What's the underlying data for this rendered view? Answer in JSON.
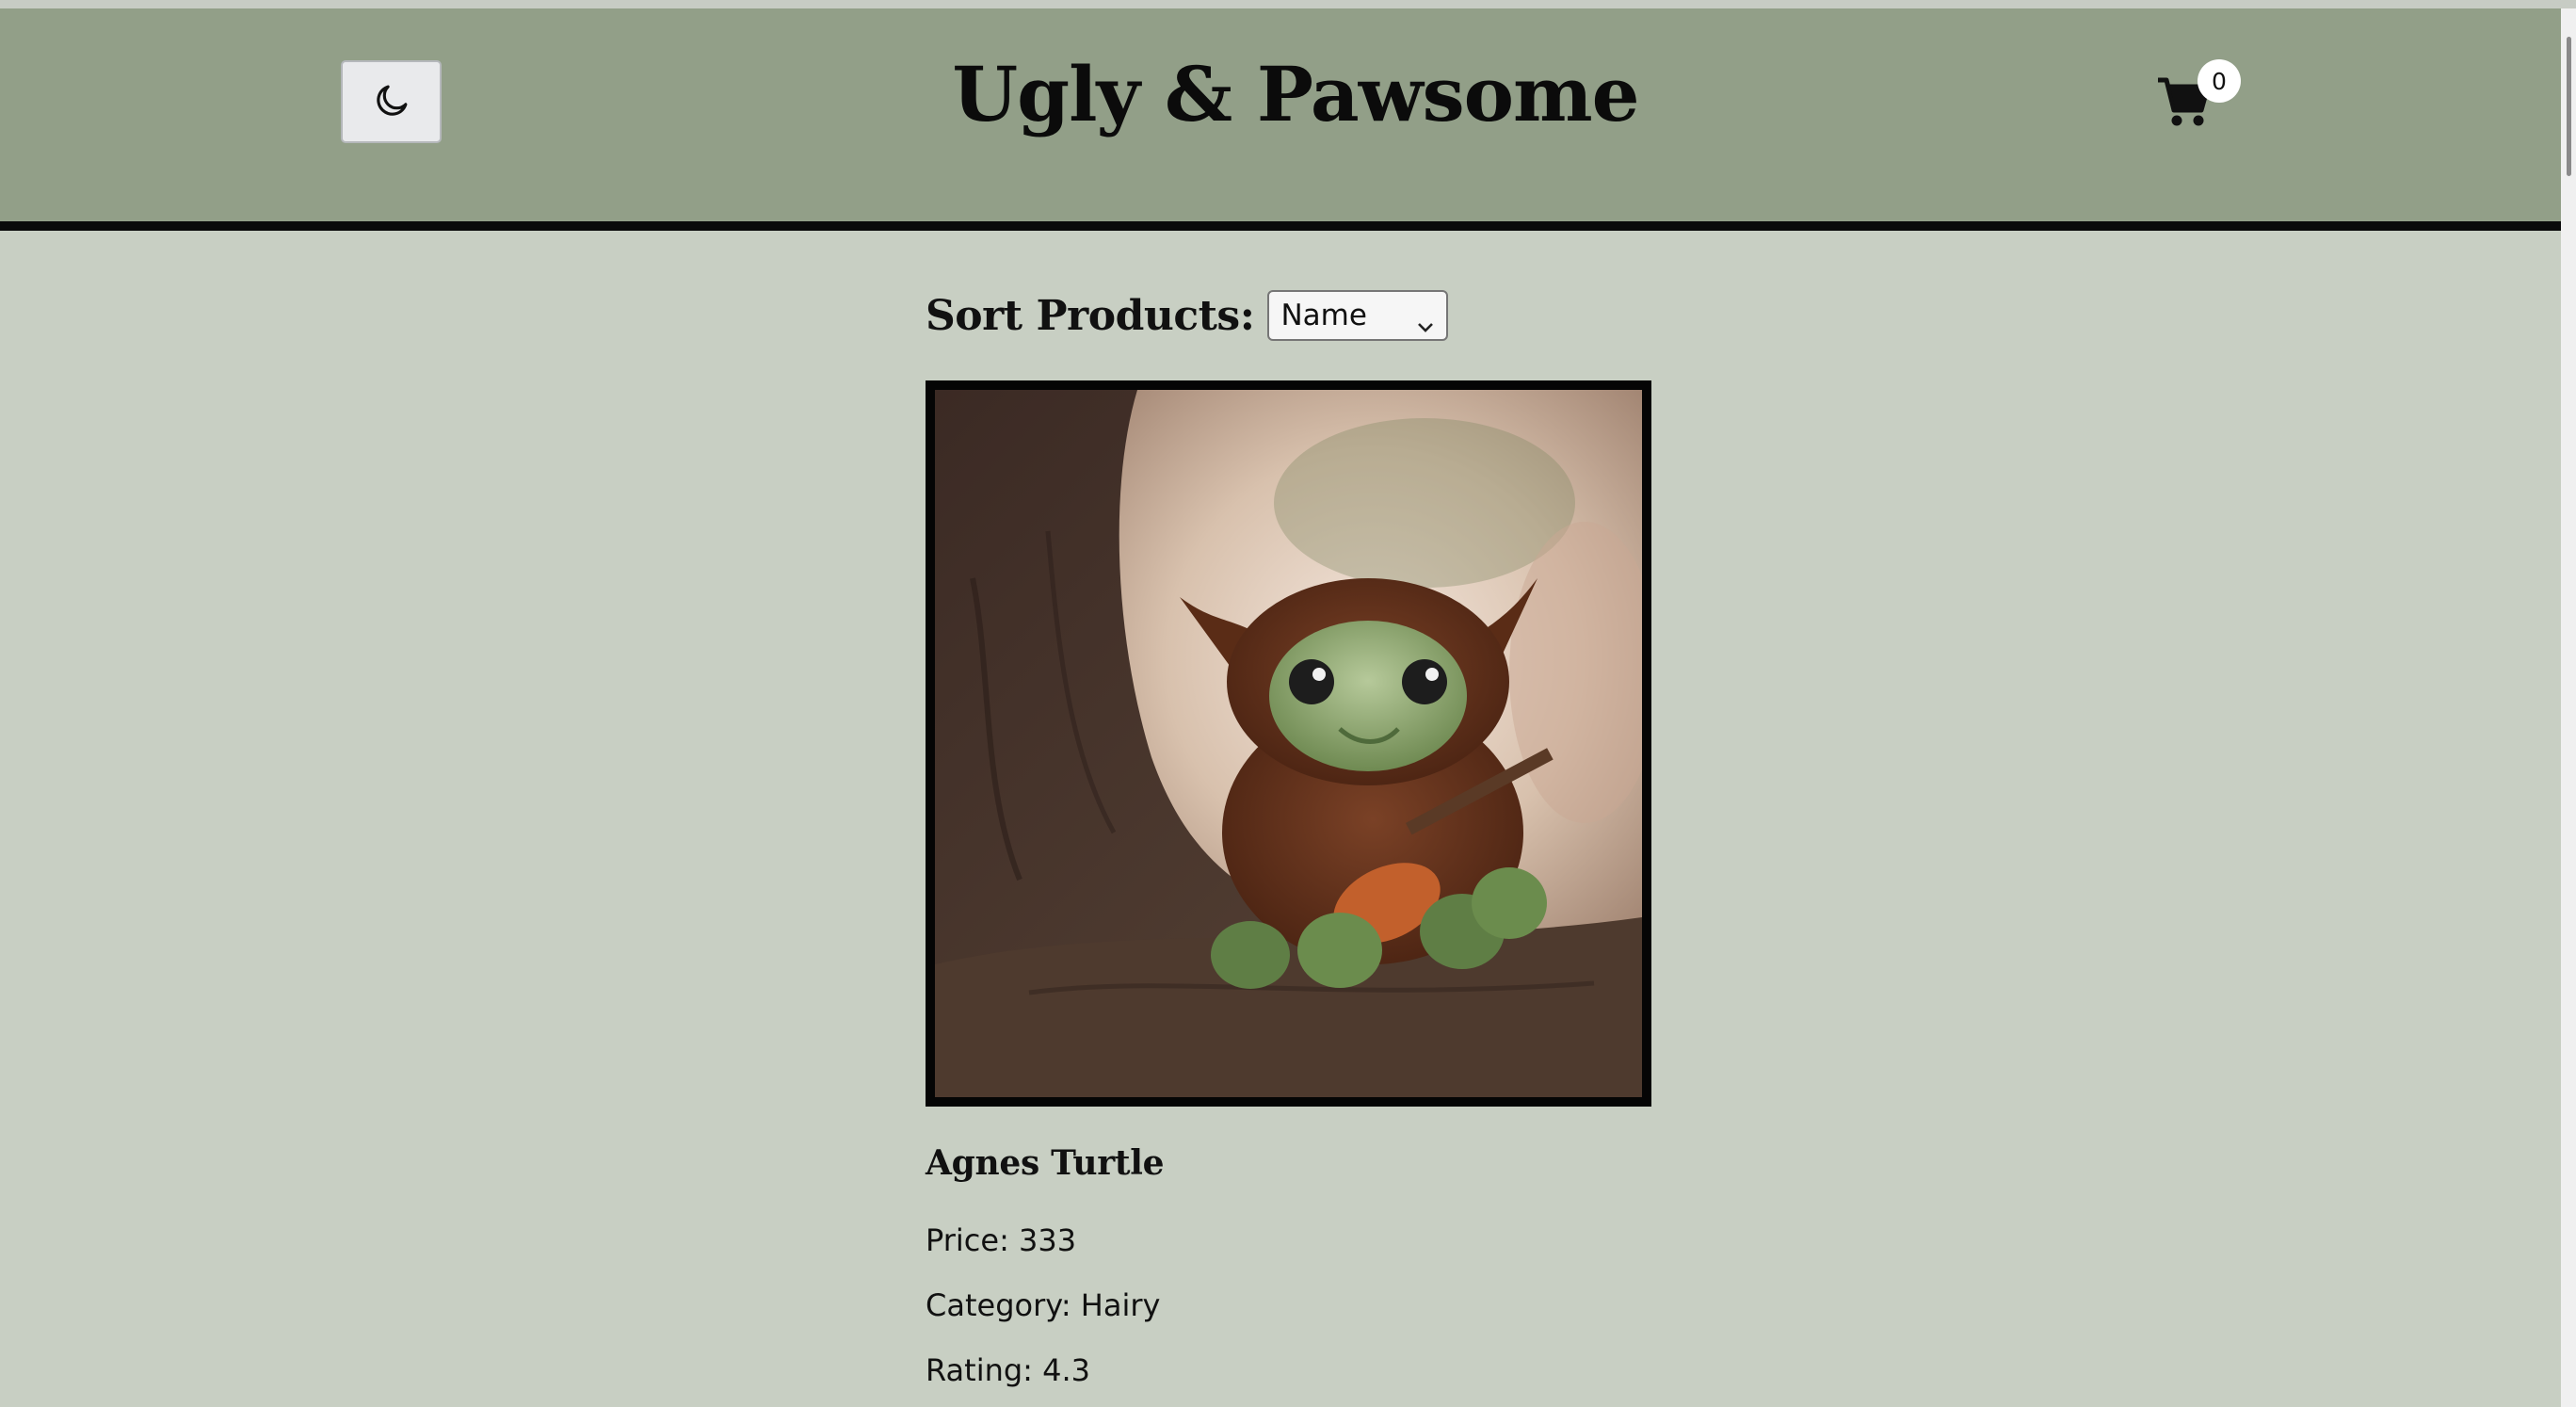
{
  "header": {
    "site_title": "Ugly & Pawsome",
    "theme_toggle_icon": "moon-icon",
    "cart_icon": "shopping-cart-icon",
    "cart_count": "0",
    "background_color": "#929f88"
  },
  "sort": {
    "label": "Sort Products:",
    "selected": "Name"
  },
  "products": [
    {
      "name": "Agnes Turtle",
      "price_text": "Price: 333",
      "category_text": "Category: Hairy",
      "rating_text": "Rating: 4.3"
    }
  ],
  "colors": {
    "page_background": "#c8cfc3",
    "header_background": "#929f88",
    "border": "#0a0a0a"
  }
}
